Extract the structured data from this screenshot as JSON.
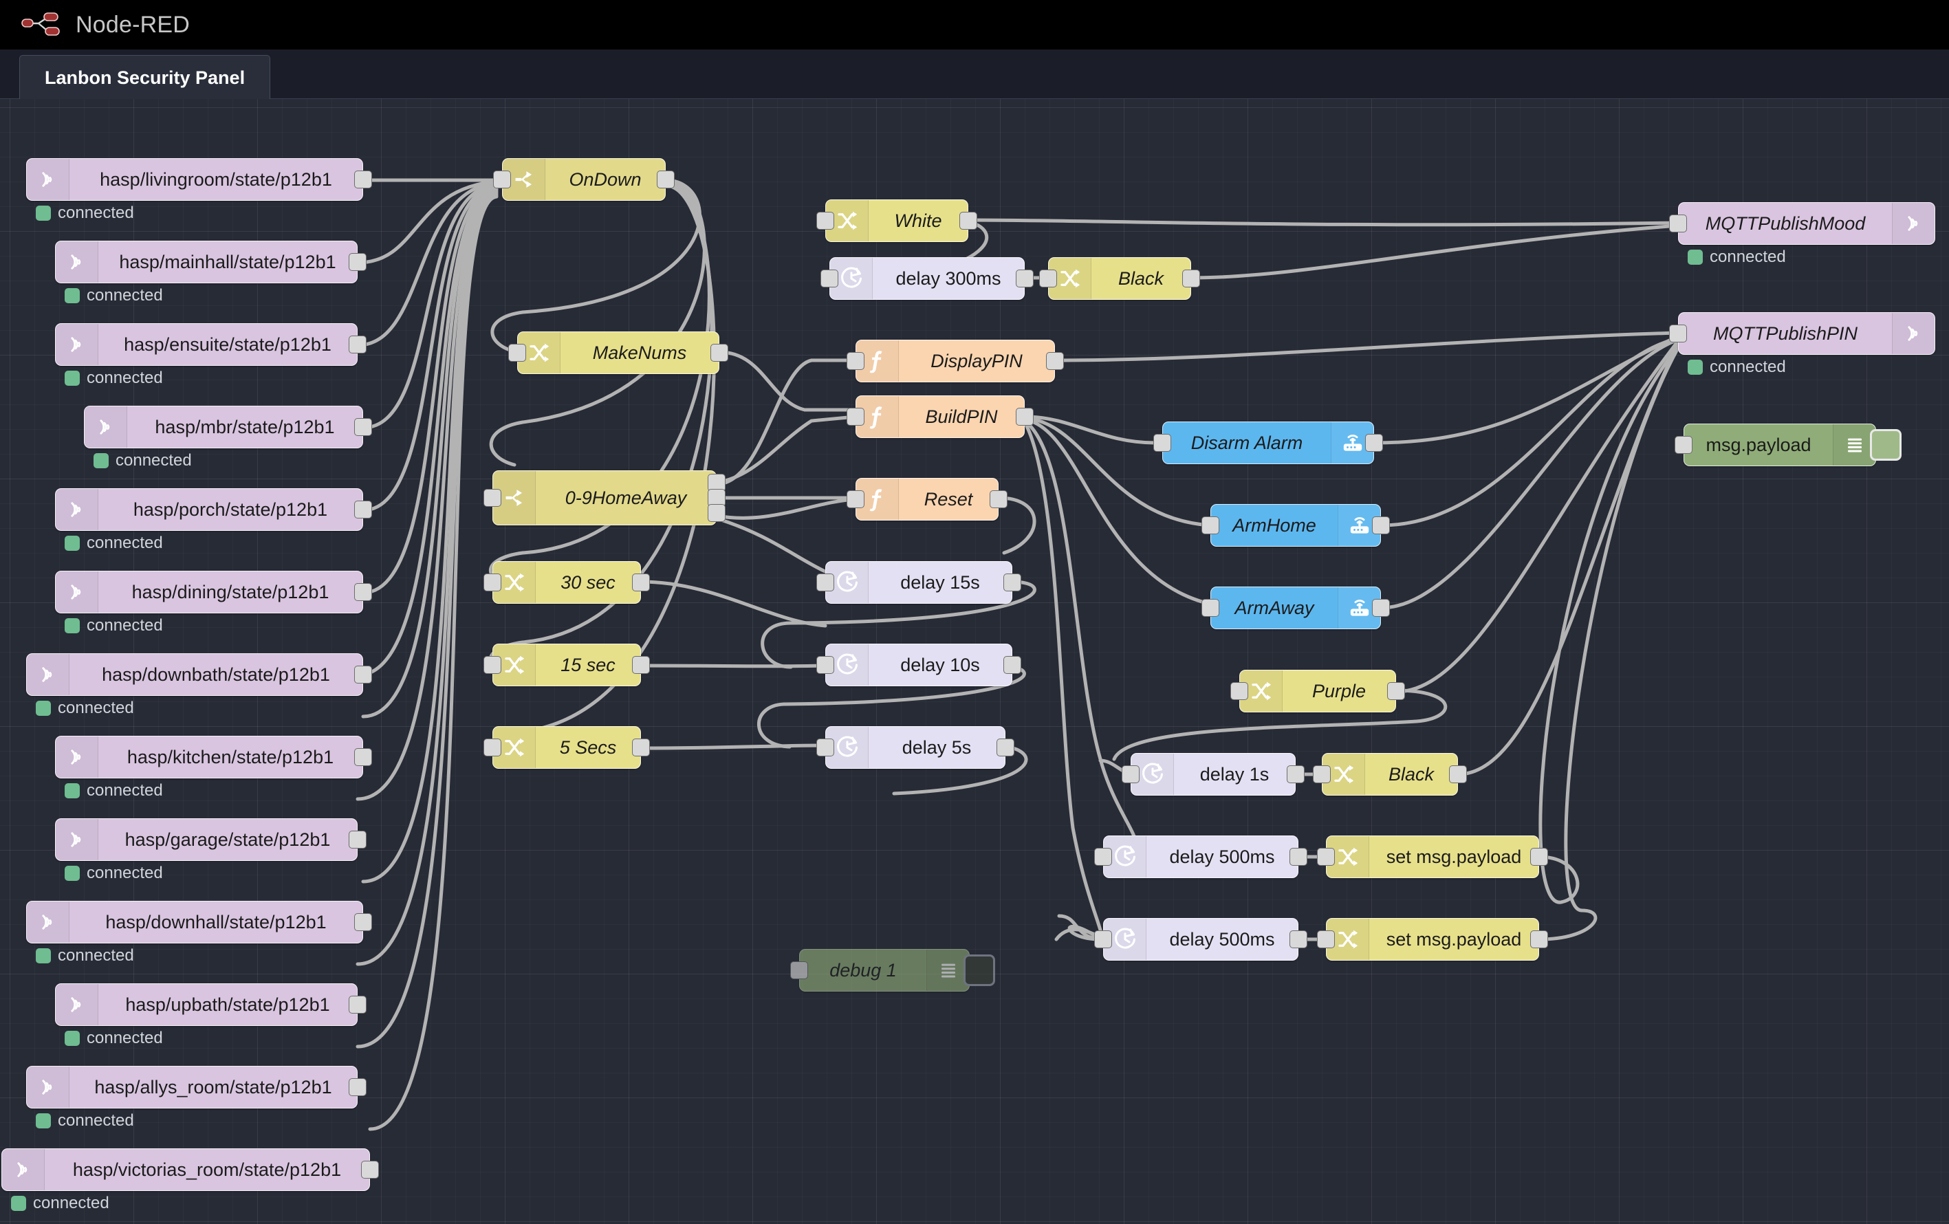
{
  "app": {
    "title": "Node-RED",
    "logo_icon": "node-red-logo-icon"
  },
  "tabs": [
    {
      "label": "Lanbon Security Panel",
      "active": true
    }
  ],
  "status_text": "connected",
  "colors": {
    "canvas": "#272b36",
    "header": "#000000",
    "mqtt_node": "#d9c5e0",
    "switch_node": "#e2d98b",
    "change_node": "#e7e08b",
    "function_node": "#fbd5b0",
    "delay_node": "#e4e0f3",
    "alexa_node": "#5cb7ef",
    "debug_node": "#90ad79",
    "status_dot": "#6fbd91",
    "wire": "#b3b3b3"
  },
  "nodes": {
    "mqtt_in": [
      {
        "label": "hasp/livingroom/state/p12b1",
        "status": "connected"
      },
      {
        "label": "hasp/mainhall/state/p12b1",
        "status": "connected"
      },
      {
        "label": "hasp/ensuite/state/p12b1",
        "status": "connected"
      },
      {
        "label": "hasp/mbr/state/p12b1",
        "status": "connected"
      },
      {
        "label": "hasp/porch/state/p12b1",
        "status": "connected"
      },
      {
        "label": "hasp/dining/state/p12b1",
        "status": "connected"
      },
      {
        "label": "hasp/downbath/state/p12b1",
        "status": "connected"
      },
      {
        "label": "hasp/kitchen/state/p12b1",
        "status": "connected"
      },
      {
        "label": "hasp/garage/state/p12b1",
        "status": "connected"
      },
      {
        "label": "hasp/downhall/state/p12b1",
        "status": "connected"
      },
      {
        "label": "hasp/upbath/state/p12b1",
        "status": "connected"
      },
      {
        "label": "hasp/allys_room/state/p12b1",
        "status": "connected"
      },
      {
        "label": "hasp/victorias_room/state/p12b1",
        "status": "connected"
      }
    ],
    "switches": [
      {
        "label": "OnDown"
      },
      {
        "label": "0-9HomeAway"
      }
    ],
    "changes": [
      {
        "label": "MakeNums"
      },
      {
        "label": "30 sec"
      },
      {
        "label": "15 sec"
      },
      {
        "label": "5 Secs"
      },
      {
        "label": "White"
      },
      {
        "label": "Black"
      },
      {
        "label": "Purple"
      },
      {
        "label": "Black"
      },
      {
        "label": "set msg.payload"
      },
      {
        "label": "set msg.payload"
      }
    ],
    "functions": [
      {
        "label": "DisplayPIN"
      },
      {
        "label": "BuildPIN"
      },
      {
        "label": "Reset"
      }
    ],
    "delays": [
      {
        "label": "delay 300ms"
      },
      {
        "label": "delay 15s"
      },
      {
        "label": "delay 10s"
      },
      {
        "label": "delay 5s"
      },
      {
        "label": "delay 1s"
      },
      {
        "label": "delay 500ms"
      },
      {
        "label": "delay 500ms"
      }
    ],
    "alexa": [
      {
        "label": "Disarm Alarm"
      },
      {
        "label": "ArmHome"
      },
      {
        "label": "ArmAway"
      }
    ],
    "mqtt_out": [
      {
        "label": "MQTTPublishMood",
        "status": "connected"
      },
      {
        "label": "MQTTPublishPIN",
        "status": "connected"
      }
    ],
    "debug": [
      {
        "label": "msg.payload",
        "enabled": true
      },
      {
        "label": "debug 1",
        "enabled": false
      }
    ]
  },
  "icons": {
    "mqtt": "wifi-signal-icon",
    "switch": "branch-fork-icon",
    "change": "shuffle-arrows-icon",
    "function": "function-f-icon",
    "delay": "clock-icon",
    "alexa": "router-wifi-icon",
    "debug": "hamburger-lines-icon"
  }
}
